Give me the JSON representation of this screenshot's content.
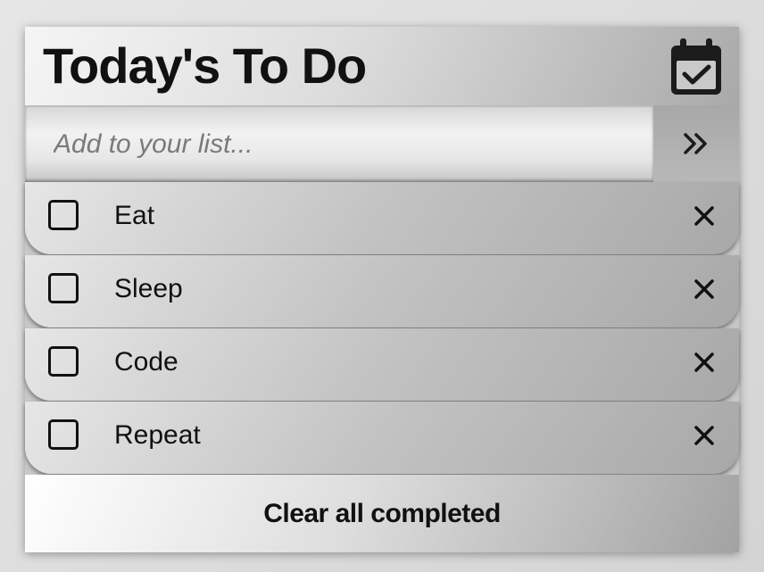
{
  "header": {
    "title": "Today's To Do",
    "calendar_icon": "calendar-check-icon"
  },
  "input": {
    "placeholder": "Add to your list...",
    "value": "",
    "submit_icon": "double-chevron-right-icon"
  },
  "todos": [
    {
      "label": "Eat",
      "completed": false
    },
    {
      "label": "Sleep",
      "completed": false
    },
    {
      "label": "Code",
      "completed": false
    },
    {
      "label": "Repeat",
      "completed": false
    }
  ],
  "footer": {
    "clear_label": "Clear all completed"
  }
}
